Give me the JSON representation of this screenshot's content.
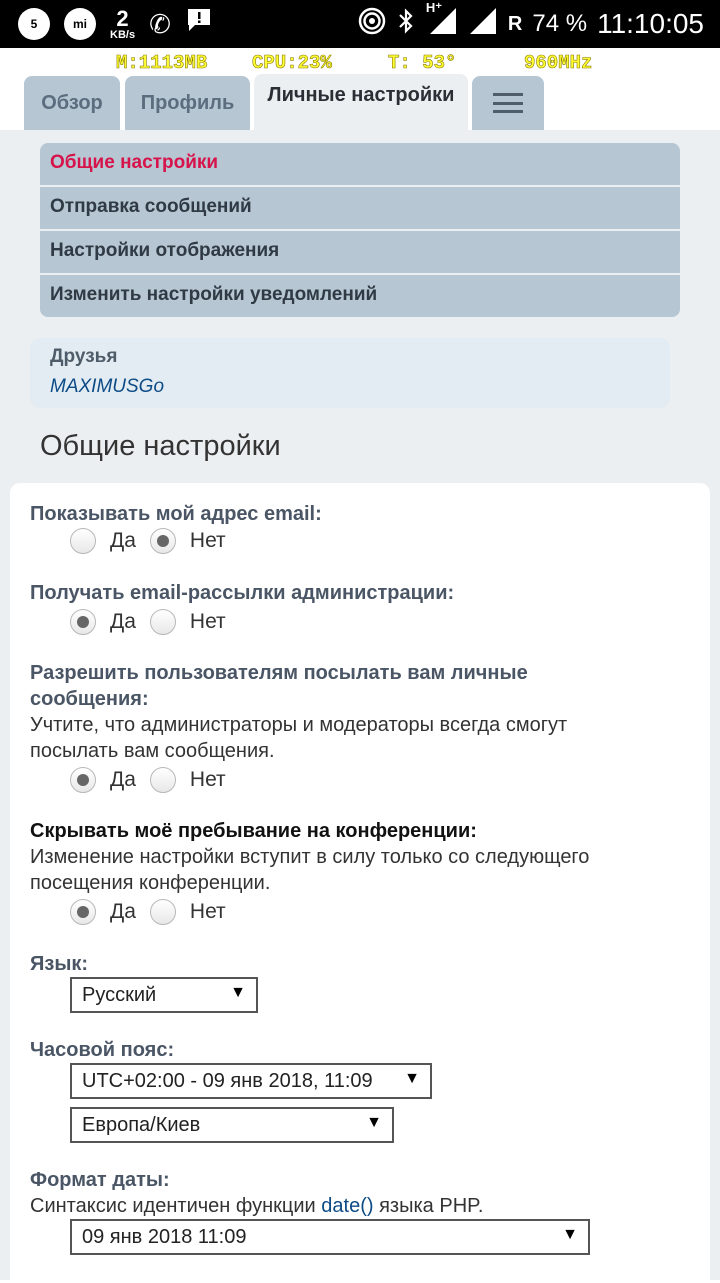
{
  "status_bar": {
    "notif1": "5",
    "notif2": "mi",
    "speed_value": "2",
    "speed_unit": "KB/s",
    "network": "H⁺",
    "roaming": "R",
    "battery": "74 %",
    "time": "11:10:05"
  },
  "monitor": {
    "memory": "M:1113MB",
    "cpu": "CPU:23%",
    "temp": "T: 53°",
    "freq": "960MHz"
  },
  "tabs": [
    {
      "label": "Обзор"
    },
    {
      "label": "Профиль"
    },
    {
      "label": "Личные настройки"
    }
  ],
  "subnav": [
    {
      "label": "Общие настройки"
    },
    {
      "label": "Отправка сообщений"
    },
    {
      "label": "Настройки отображения"
    },
    {
      "label": "Изменить настройки уведомлений"
    }
  ],
  "friends": {
    "heading": "Друзья",
    "name": "MAXIMUSGo"
  },
  "section_title": "Общие настройки",
  "form": {
    "q1": {
      "label": "Показывать мой адрес email:",
      "yes": "Да",
      "no": "Нет",
      "selected": "no"
    },
    "q2": {
      "label": "Получать email-рассылки администрации:",
      "yes": "Да",
      "no": "Нет",
      "selected": "yes"
    },
    "q3": {
      "label_line1": "Разрешить пользователям посылать вам личные",
      "label_line2": "сообщения:",
      "note_line1": "Учтите, что администраторы и модераторы всегда смогут",
      "note_line2": "посылать вам сообщения.",
      "yes": "Да",
      "no": "Нет",
      "selected": "yes"
    },
    "q4": {
      "label": "Скрывать моё пребывание на конференции:",
      "note_line1": "Изменение настройки вступит в силу только со следующего",
      "note_line2": "посещения конференции.",
      "yes": "Да",
      "no": "Нет",
      "selected": "yes"
    },
    "language": {
      "label": "Язык:",
      "value": "Русский"
    },
    "timezone": {
      "label": "Часовой пояс:",
      "value": "UTC+02:00 - 09 янв 2018, 11:09",
      "zone": "Европа/Киев"
    },
    "date_format": {
      "label": "Формат даты:",
      "note_before": "Синтаксис идентичен функции ",
      "note_link": "date()",
      "note_after": " языка PHP.",
      "value": "09 янв 2018 11:09"
    }
  },
  "colors": {
    "tab_bg": "#b6c6d3",
    "active_tab_bg": "#eceff1",
    "active_subnav": "#d6134a",
    "link": "#0c4b86"
  }
}
